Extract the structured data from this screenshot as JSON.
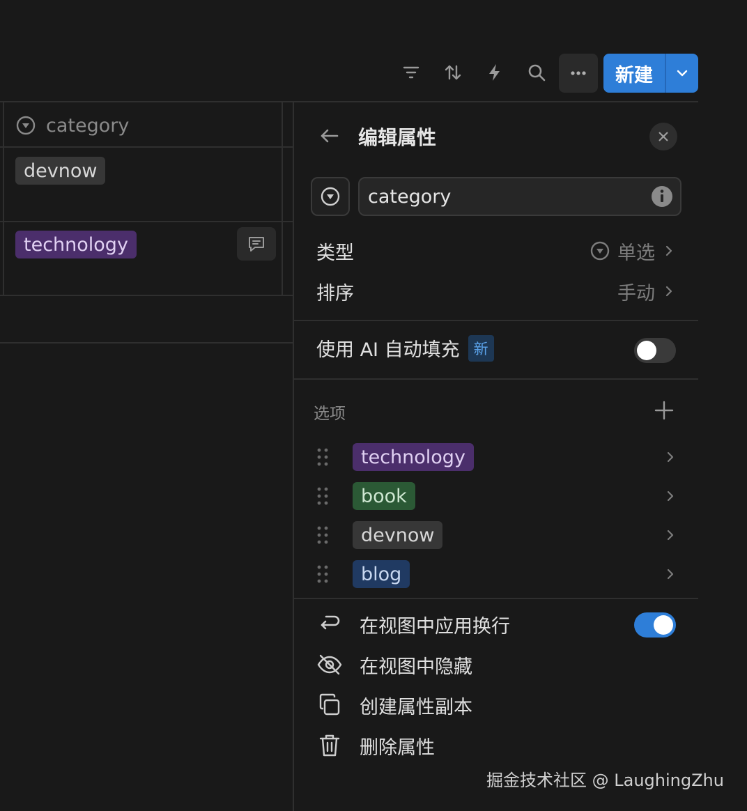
{
  "toolbar": {
    "icons": [
      "filter-icon",
      "sort-icon",
      "lightning-icon",
      "search-icon",
      "more-icon"
    ],
    "new_button_label": "新建"
  },
  "table": {
    "column_header": "category",
    "rows": [
      {
        "tag": "devnow",
        "color": "gray"
      },
      {
        "tag": "technology",
        "color": "purple"
      }
    ]
  },
  "panel": {
    "title": "编辑属性",
    "property_name": "category",
    "type_label": "类型",
    "type_value": "单选",
    "sort_label": "排序",
    "sort_value": "手动",
    "ai_label": "使用 AI 自动填充",
    "ai_badge": "新",
    "ai_enabled": false,
    "options_label": "选项",
    "options": [
      {
        "name": "technology",
        "color": "#4b2e6b"
      },
      {
        "name": "book",
        "color": "#2b5935"
      },
      {
        "name": "devnow",
        "color": "#373737"
      },
      {
        "name": "blog",
        "color": "#203a62"
      }
    ],
    "actions": {
      "wrap_label": "在视图中应用换行",
      "wrap_enabled": true,
      "hide_label": "在视图中隐藏",
      "duplicate_label": "创建属性副本",
      "delete_label": "删除属性"
    }
  },
  "watermark": "掘金技术社区 @ LaughingZhu",
  "colors": {
    "accent": "#2e7ed8",
    "background": "#191919"
  }
}
